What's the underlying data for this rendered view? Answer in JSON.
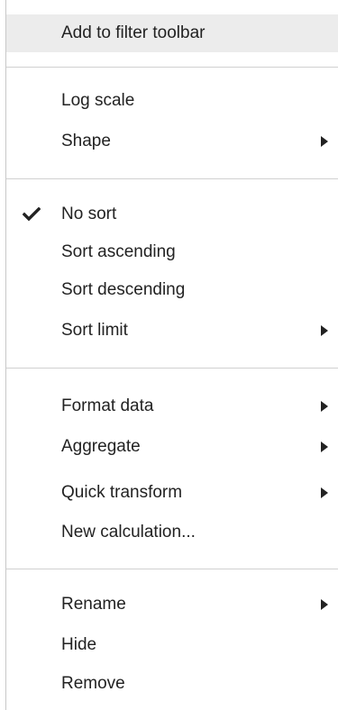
{
  "menu": {
    "items": [
      {
        "label": "Add to filter toolbar",
        "checked": false,
        "submenu": false,
        "highlighted": true
      },
      {
        "label": "Log scale",
        "checked": false,
        "submenu": false
      },
      {
        "label": "Shape",
        "checked": false,
        "submenu": true
      },
      {
        "label": "No sort",
        "checked": true,
        "submenu": false
      },
      {
        "label": "Sort ascending",
        "checked": false,
        "submenu": false
      },
      {
        "label": "Sort descending",
        "checked": false,
        "submenu": false
      },
      {
        "label": "Sort limit",
        "checked": false,
        "submenu": true
      },
      {
        "label": "Format data",
        "checked": false,
        "submenu": true
      },
      {
        "label": "Aggregate",
        "checked": false,
        "submenu": true
      },
      {
        "label": "Quick transform",
        "checked": false,
        "submenu": true
      },
      {
        "label": "New calculation...",
        "checked": false,
        "submenu": false
      },
      {
        "label": "Rename",
        "checked": false,
        "submenu": true
      },
      {
        "label": "Hide",
        "checked": false,
        "submenu": false
      },
      {
        "label": "Remove",
        "checked": false,
        "submenu": false
      }
    ]
  },
  "icons": {
    "check": "checkmark-icon",
    "submenu": "triangle-right-icon"
  },
  "colors": {
    "highlight": "#ececec",
    "text": "#222222",
    "divider": "#d0d0d0"
  }
}
